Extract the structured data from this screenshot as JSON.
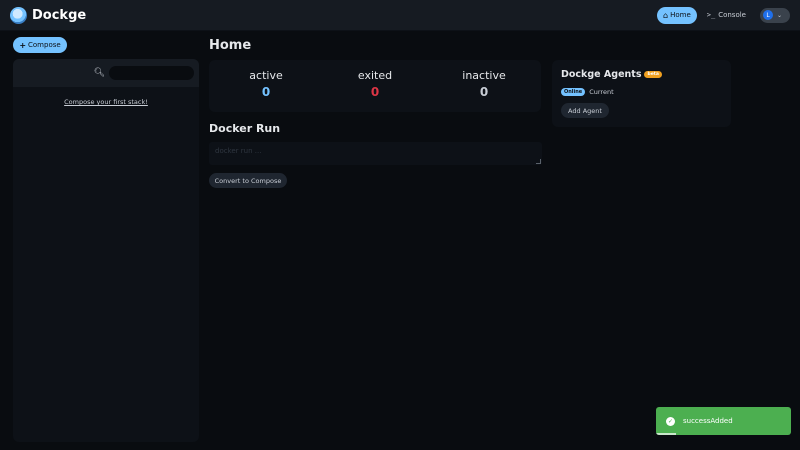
{
  "header": {
    "brand": "Dockge",
    "nav": {
      "home_label": "Home",
      "console_label": "Console"
    },
    "profile": {
      "avatar_letter": "L"
    }
  },
  "compose_button": {
    "label": "Compose"
  },
  "sidebar": {
    "search": {
      "value": "",
      "placeholder": ""
    },
    "empty_link": "Compose your first stack!"
  },
  "main": {
    "title": "Home",
    "stats": [
      {
        "label": "active",
        "value": "0"
      },
      {
        "label": "exited",
        "value": "0"
      },
      {
        "label": "inactive",
        "value": "0"
      }
    ],
    "docker_run": {
      "title": "Docker Run",
      "placeholder": "docker run ...",
      "convert_label": "Convert to Compose"
    }
  },
  "agents": {
    "title": "Dockge Agents",
    "beta_label": "beta",
    "items": [
      {
        "status": "Online",
        "name": "Current"
      }
    ],
    "add_label": "Add Agent"
  },
  "toast": {
    "message": "successAdded",
    "progress": 0.15
  },
  "colors": {
    "accent": "#74c2ff",
    "danger": "#dc3545",
    "success": "#4caf50",
    "beta": "#f0a020"
  }
}
